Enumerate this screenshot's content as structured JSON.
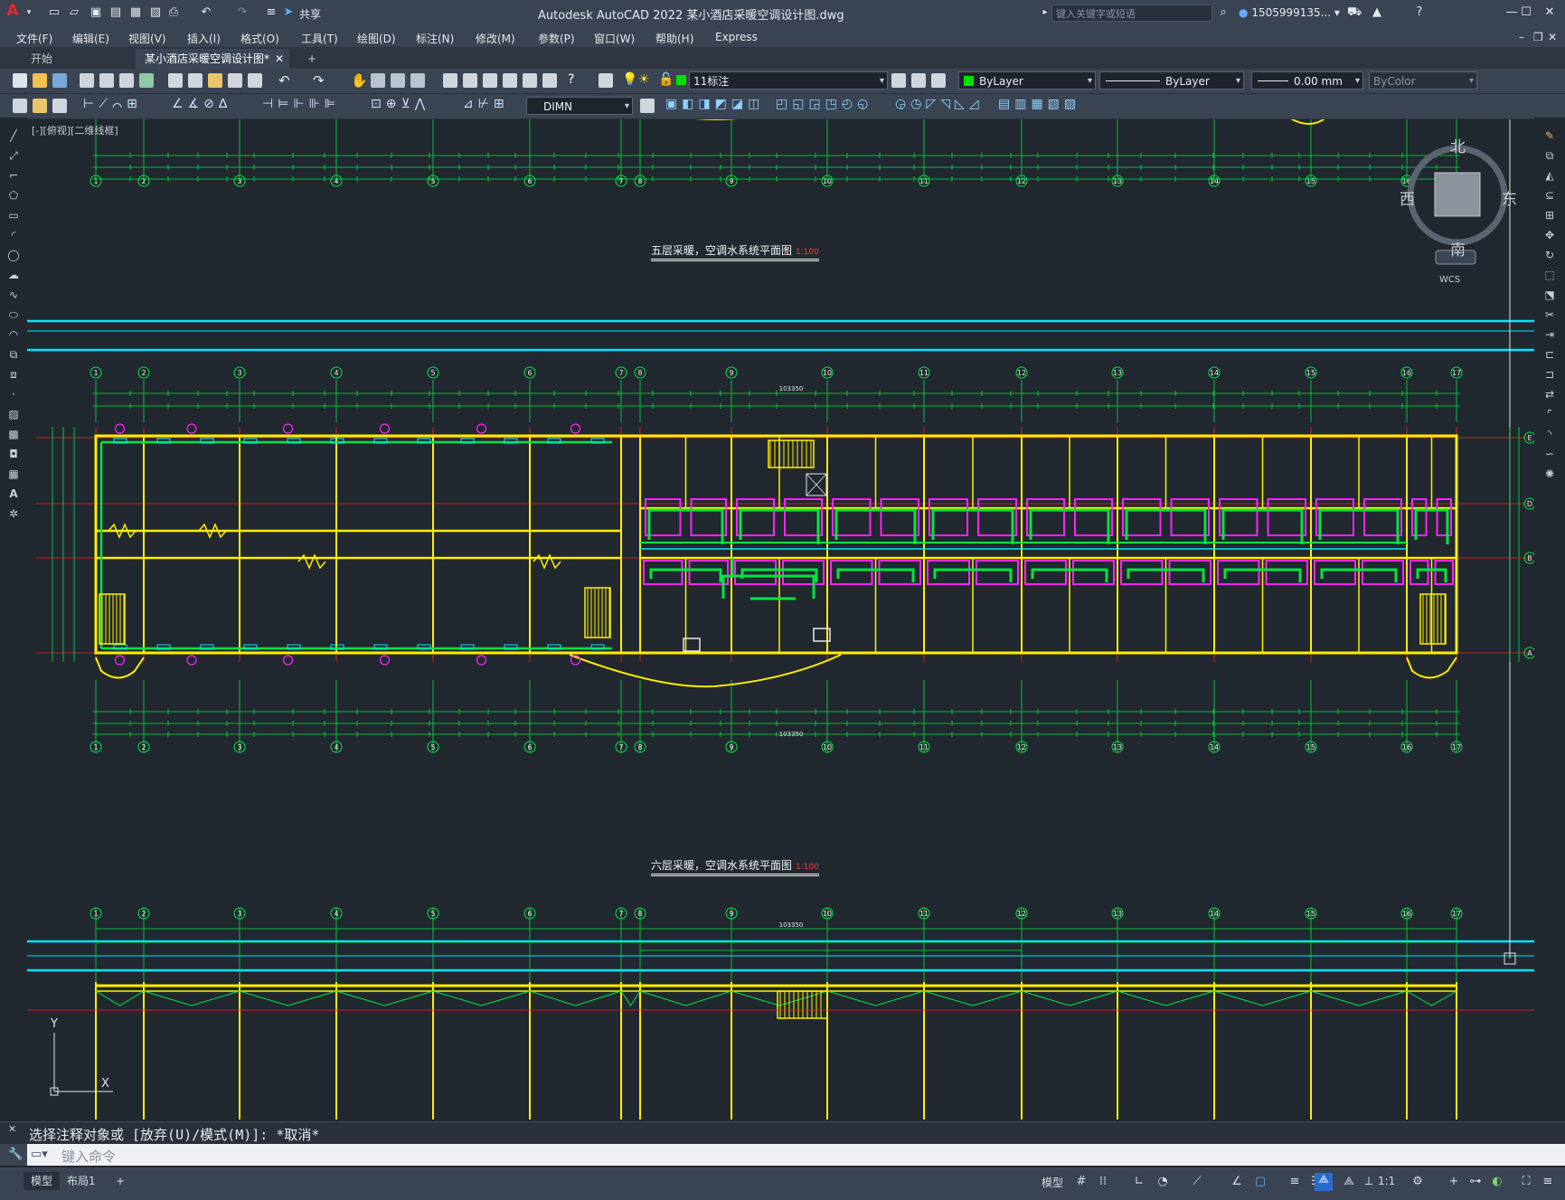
{
  "app": {
    "title": "Autodesk AutoCAD 2022    某小酒店采暖空调设计图.dwg",
    "share_label": "共享",
    "search_placeholder": "键入关键字或短语",
    "user": "1505999135...",
    "accent_color": "#c8102e"
  },
  "menu": [
    "文件(F)",
    "编辑(E)",
    "视图(V)",
    "插入(I)",
    "格式(O)",
    "工具(T)",
    "绘图(D)",
    "标注(N)",
    "修改(M)",
    "参数(P)",
    "窗口(W)",
    "帮助(H)",
    "Express"
  ],
  "tabs": [
    {
      "label": "开始",
      "active": false
    },
    {
      "label": "某小酒店采暖空调设计图*",
      "active": true
    }
  ],
  "toolbar": {
    "layer": "11标注",
    "color": "ByLayer",
    "linetype": "ByLayer",
    "lineweight": "0.00 mm",
    "plotstyle": "ByColor",
    "dimstyle": "DIMN"
  },
  "viewport": {
    "label": "[-][俯视][二维线框]",
    "compass": {
      "north": "北",
      "south": "南",
      "east": "东",
      "west": "西",
      "wcs": "WCS"
    }
  },
  "drawing": {
    "caption_5": "五层采暖，空调水系统平面图",
    "caption_6": "六层采暖，空调水系统平面图",
    "scale": "1:100",
    "axis_numbers": [
      "1",
      "2",
      "3",
      "4",
      "5",
      "6",
      "7",
      "8",
      "9",
      "10",
      "11",
      "12",
      "13",
      "14",
      "15",
      "16",
      "17"
    ],
    "row_letters": [
      "E",
      "D",
      "B",
      "A"
    ],
    "total_dim": "103350"
  },
  "command": {
    "history": "选择注释对象或 [放弃(U)/模式(M)]: *取消*",
    "placeholder": "键入命令"
  },
  "status": {
    "layouts": [
      "模型",
      "布局1"
    ],
    "scale": "1:1"
  }
}
